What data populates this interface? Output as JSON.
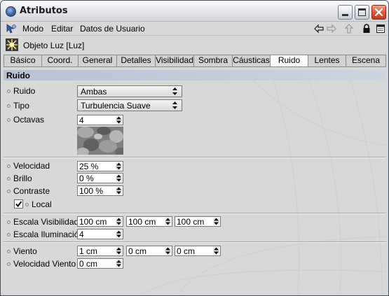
{
  "window": {
    "title": "Atributos"
  },
  "menubar": {
    "items": [
      "Modo",
      "Editar",
      "Datos de Usuario"
    ]
  },
  "object": {
    "label": "Objeto Luz  [Luz]"
  },
  "tabs": {
    "items": [
      "Básico",
      "Coord.",
      "General",
      "Detalles",
      "Visibilidad",
      "Sombra",
      "Cáusticas",
      "Ruido",
      "Lentes",
      "Escena"
    ],
    "active": "Ruido"
  },
  "section": {
    "title": "Ruido"
  },
  "fields": {
    "ruido": {
      "label": "Ruido",
      "value": "Ambas"
    },
    "tipo": {
      "label": "Tipo",
      "value": "Turbulencia Suave"
    },
    "octavas": {
      "label": "Octavas",
      "value": "4"
    },
    "velocidad": {
      "label": "Velocidad",
      "value": "25 %"
    },
    "brillo": {
      "label": "Brillo",
      "value": "0 %"
    },
    "contraste": {
      "label": "Contraste",
      "value": "100 %"
    },
    "local": {
      "label": "Local",
      "checked": true
    },
    "escala_visibilidad": {
      "label": "Escala Visibilidad",
      "values": [
        "100 cm",
        "100 cm",
        "100 cm"
      ]
    },
    "escala_iluminacion": {
      "label": "Escala Iluminación",
      "value": "4"
    },
    "viento": {
      "label": "Viento",
      "values": [
        "1 cm",
        "0 cm",
        "0 cm"
      ]
    },
    "velocidad_viento": {
      "label": "Velocidad Viento",
      "value": "0 cm"
    }
  },
  "colors": {
    "section_header": "#c5cddc",
    "close_button": "#e1583a",
    "panel_bg": "#d8d8d8"
  }
}
